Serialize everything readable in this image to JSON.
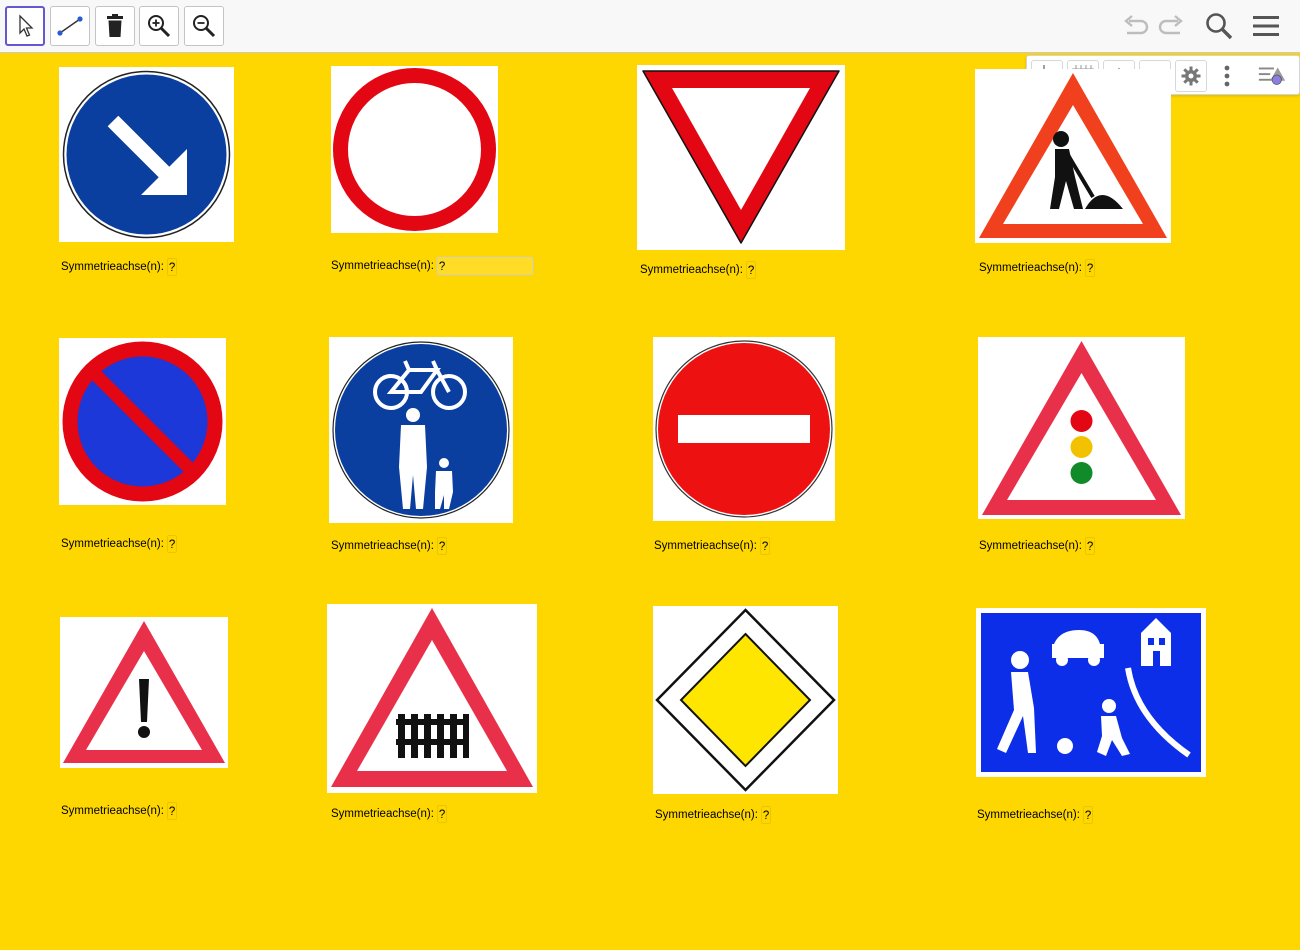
{
  "toolbar": {
    "tools": [
      {
        "name": "move-tool",
        "icon": "cursor-arrow-icon",
        "active": true
      },
      {
        "name": "segment-tool",
        "icon": "segment-icon",
        "active": false
      },
      {
        "name": "delete-tool",
        "icon": "trash-icon",
        "active": false
      },
      {
        "name": "zoom-in-tool",
        "icon": "zoom-in-icon",
        "active": false
      },
      {
        "name": "zoom-out-tool",
        "icon": "zoom-out-icon",
        "active": false
      }
    ],
    "right_icons": [
      "undo-icon",
      "redo-icon",
      "search-icon",
      "hamburger-menu-icon"
    ]
  },
  "stylebar": {
    "buttons": [
      "axes-icon",
      "grid-icon",
      "home-icon",
      "magnet-icon",
      "gear-icon",
      "more-vertical-icon",
      "style-toggle-icon"
    ]
  },
  "colors": {
    "background": "#ffd700",
    "sign_red": "#e30613",
    "sign_blue": "#0a3fa0",
    "accent": "#6557d2"
  },
  "answer_placeholder": "?",
  "signs": [
    {
      "id": 1,
      "description": "keep-right-arrow-sign",
      "label": "Symmetrieachse(n):",
      "answer": "?"
    },
    {
      "id": 2,
      "description": "no-vehicles-sign",
      "label": "Symmetrieachse(n):",
      "answer": "?"
    },
    {
      "id": 3,
      "description": "yield-sign",
      "label": "Symmetrieachse(n):",
      "answer": "?"
    },
    {
      "id": 4,
      "description": "road-works-sign",
      "label": "Symmetrieachse(n):",
      "answer": "?"
    },
    {
      "id": 5,
      "description": "no-parking-sign",
      "label": "Symmetrieachse(n):",
      "answer": "?"
    },
    {
      "id": 6,
      "description": "shared-path-sign",
      "label": "Symmetrieachse(n):",
      "answer": "?"
    },
    {
      "id": 7,
      "description": "no-entry-sign",
      "label": "Symmetrieachse(n):",
      "answer": "?"
    },
    {
      "id": 8,
      "description": "traffic-lights-ahead-sign",
      "label": "Symmetrieachse(n):",
      "answer": "?"
    },
    {
      "id": 9,
      "description": "danger-sign",
      "label": "Symmetrieachse(n):",
      "answer": "?"
    },
    {
      "id": 10,
      "description": "level-crossing-gated-sign",
      "label": "Symmetrieachse(n):",
      "answer": "?"
    },
    {
      "id": 11,
      "description": "priority-road-sign",
      "label": "Symmetrieachse(n):",
      "answer": "?"
    },
    {
      "id": 12,
      "description": "play-street-sign",
      "label": "Symmetrieachse(n):",
      "answer": "?"
    }
  ]
}
